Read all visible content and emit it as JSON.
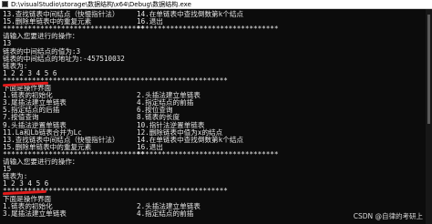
{
  "window": {
    "title": "D:\\visualStudio\\storage\\数据结构\\x64\\Debug\\数据结构.exe"
  },
  "console": {
    "lines": [
      {
        "left": "13.查找链表中间结点（快慢指针法）",
        "right": "14.在单链表中查找倒数第k个结点"
      },
      {
        "left": "15.删除单链表中的重复元素",
        "right": "16.退出"
      },
      {
        "left": "**********************************",
        "right": "**********************************"
      },
      {
        "left": "请输入您要进行的操作：",
        "right": ""
      },
      {
        "left": "13",
        "right": ""
      },
      {
        "left": "链表的中间结点的值为:3",
        "right": ""
      },
      {
        "left": "链表的中间结点的地址为:-457510032",
        "right": ""
      },
      {
        "left": "链表为:",
        "right": ""
      },
      {
        "left": "1 2 2 3 4 5 6",
        "right": ""
      },
      {
        "left": "******************************************************",
        "right": ""
      },
      {
        "left": "下面是操作界面",
        "right": ""
      },
      {
        "left": "1.链表的初始化",
        "right": "2.头插法建立单链表"
      },
      {
        "left": "3.尾插法建立单链表",
        "right": "4.指定结点的前插"
      },
      {
        "left": "5.指定结点的后插",
        "right": "6.按位查询"
      },
      {
        "left": "7.按值查询",
        "right": "8.链表的长度"
      },
      {
        "left": "9.头插法逆置单链表",
        "right": "10.指针法逆置单链表"
      },
      {
        "left": "11.La和Lb链表合并为Lc",
        "right": "12.删除链表中值为x的结点"
      },
      {
        "left": "13.查找链表中间结点（快慢指针法）",
        "right": "14.在单链表中查找倒数第k个结点"
      },
      {
        "left": "15.删除单链表中的重复元素",
        "right": "16.退出"
      },
      {
        "left": "**********************************",
        "right": "**********************************"
      },
      {
        "left": "请输入您要进行的操作：",
        "right": ""
      },
      {
        "left": "15",
        "right": ""
      },
      {
        "left": "链表为:",
        "right": ""
      },
      {
        "left": "1 2 3 4 5 6",
        "right": ""
      },
      {
        "left": "******************************************************",
        "right": ""
      },
      {
        "left": "下面是操作界面",
        "right": ""
      },
      {
        "left": "1.链表的初始化",
        "right": "2.头插法建立单链表"
      },
      {
        "left": "3.尾插法建立单链表",
        "right": "4.指定结点的前插"
      }
    ]
  },
  "watermark": "CSDN @自律的考研上",
  "colors": {
    "console_bg": "#0c0c0c",
    "console_text": "#e8e8e8",
    "annotation_red": "#e21b1b",
    "titlebar_bg": "#ffffff"
  },
  "icons": {
    "app": "console-app-icon"
  }
}
